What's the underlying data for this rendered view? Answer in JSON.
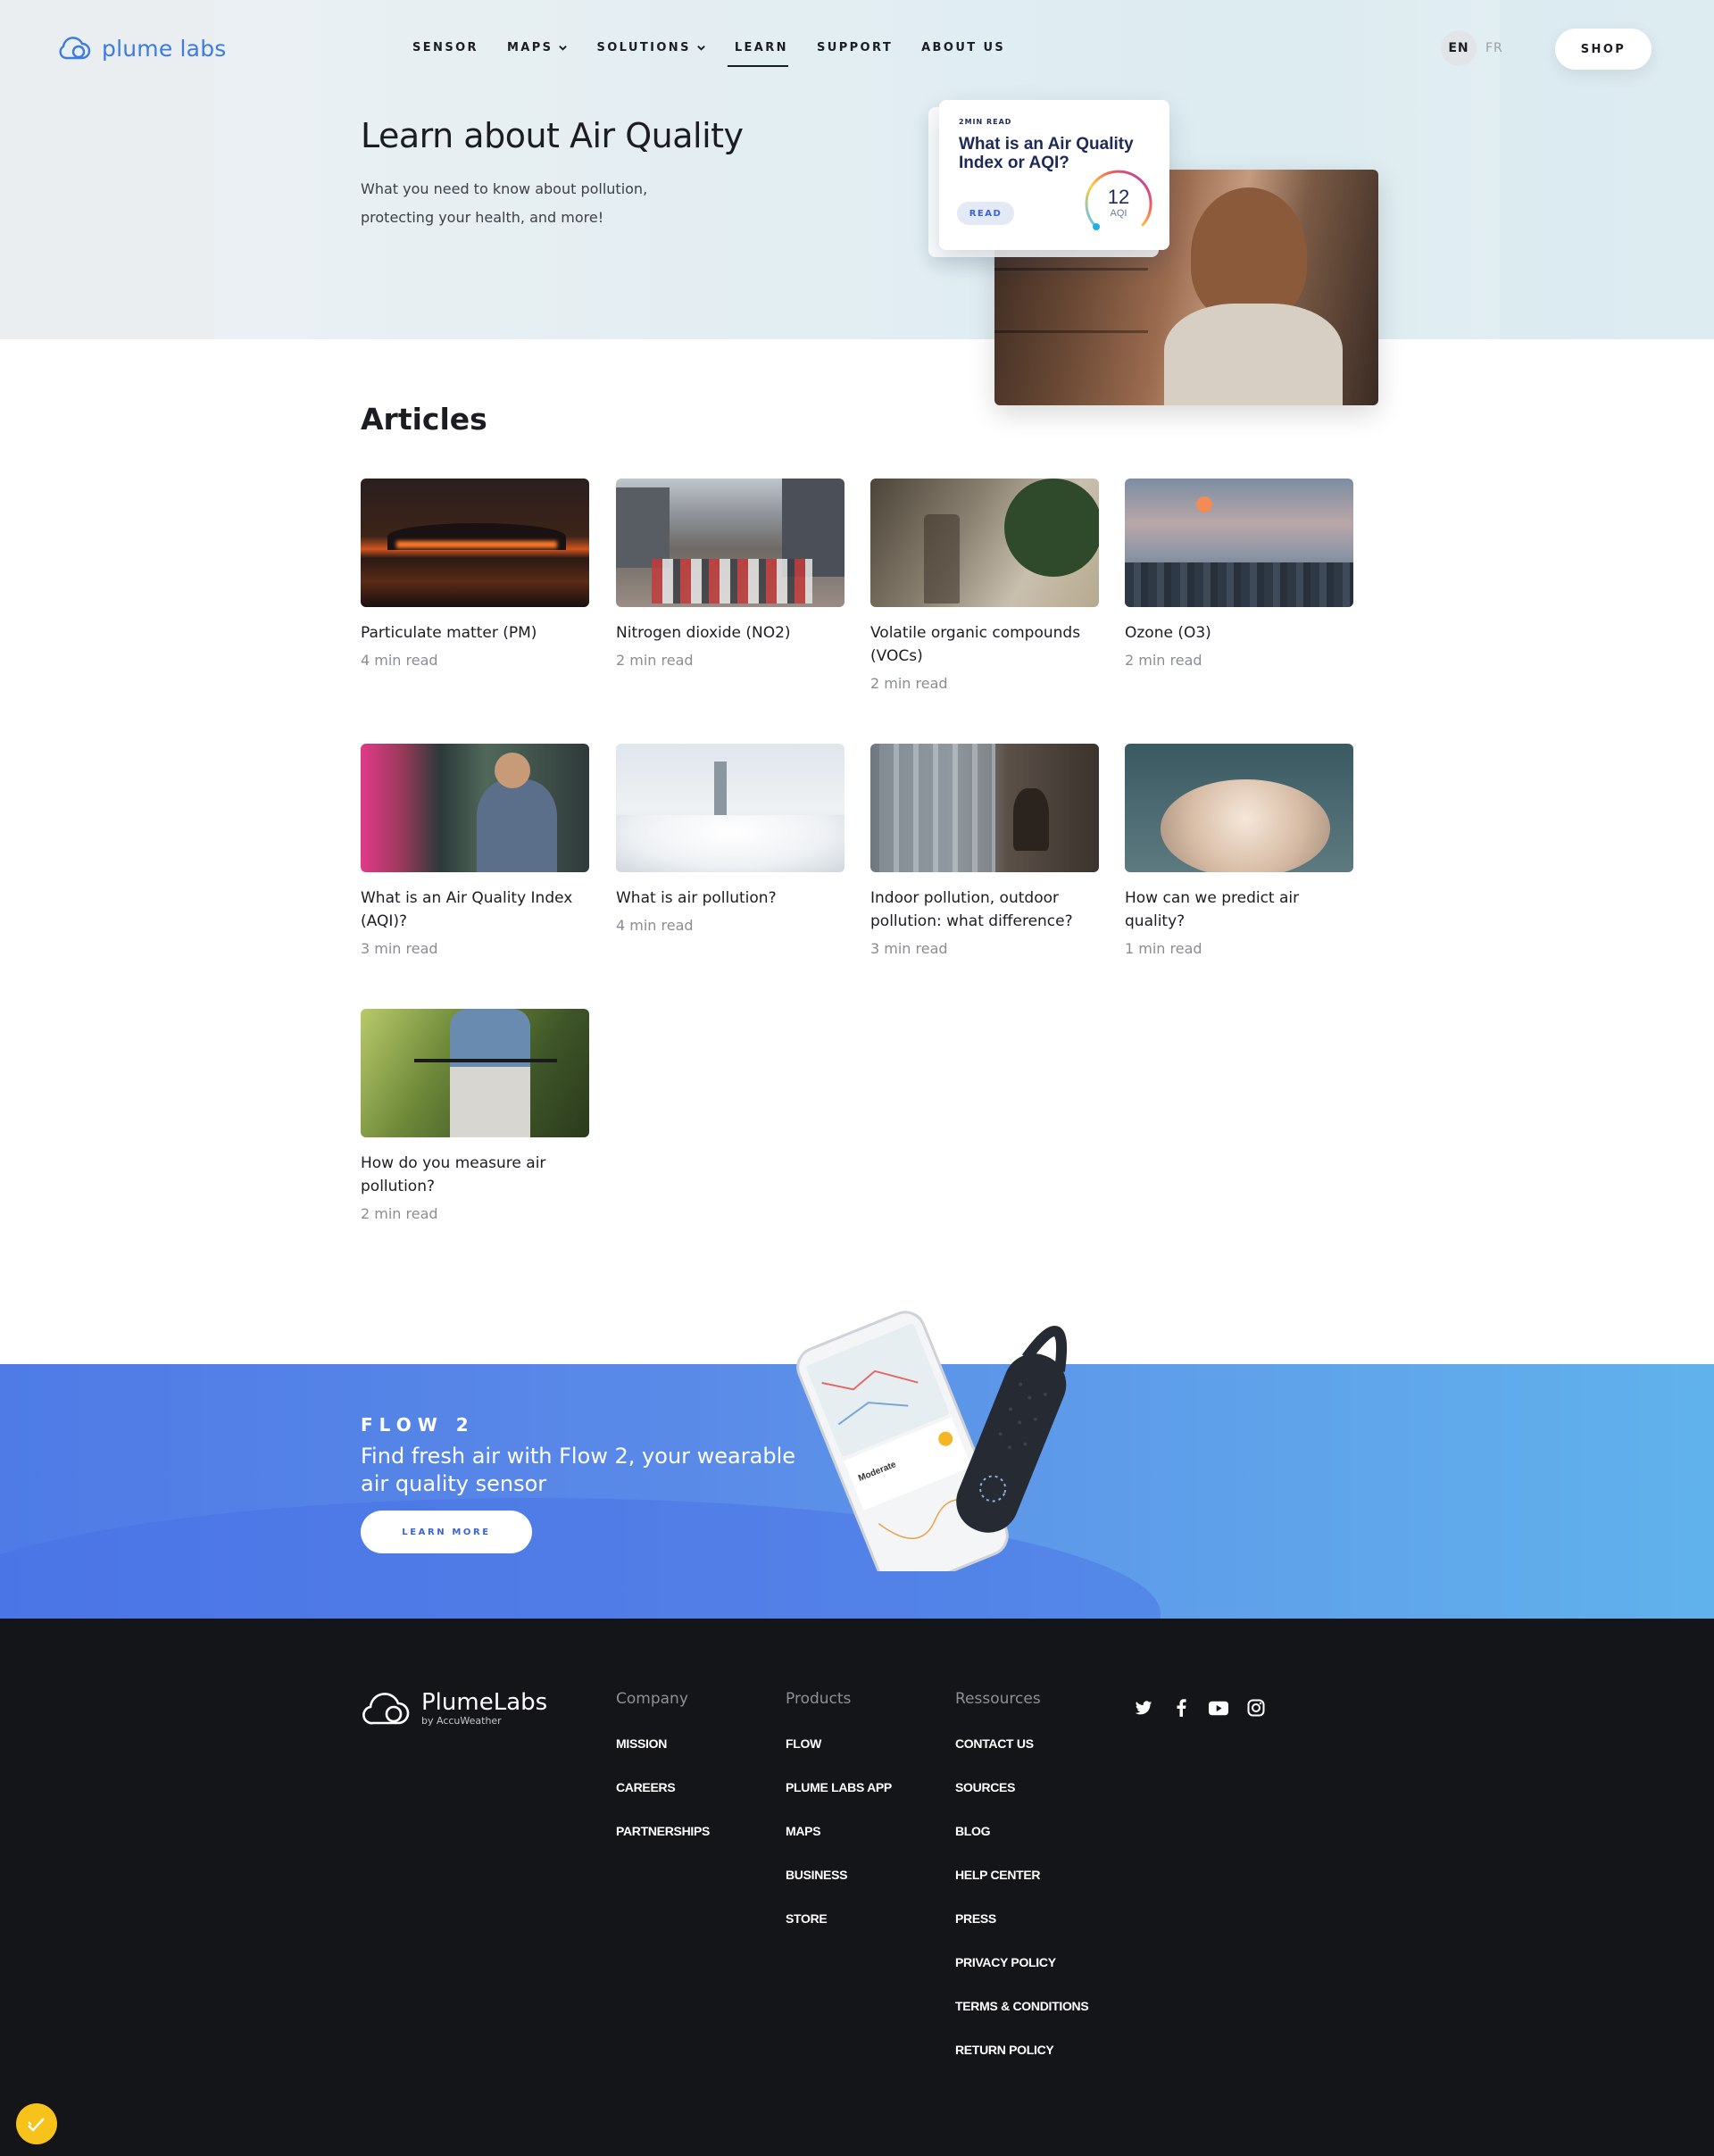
{
  "brand": {
    "logo_text": "plume labs"
  },
  "nav": {
    "items": [
      {
        "label": "SENSOR",
        "has_dropdown": false
      },
      {
        "label": "MAPS",
        "has_dropdown": true
      },
      {
        "label": "SOLUTIONS",
        "has_dropdown": true
      },
      {
        "label": "LEARN",
        "has_dropdown": false,
        "active": true
      },
      {
        "label": "SUPPORT",
        "has_dropdown": false
      },
      {
        "label": "ABOUT US",
        "has_dropdown": false
      }
    ],
    "lang_en": "EN",
    "lang_fr": "FR",
    "shop_label": "SHOP"
  },
  "hero": {
    "title": "Learn about Air Quality",
    "subtitle": "What you need to know about pollution, protecting your health, and more!",
    "card": {
      "kicker": "2MIN READ",
      "title": "What is an Air Quality Index or AQI?",
      "read_label": "READ",
      "aqi_value": "12",
      "aqi_unit": "AQI"
    }
  },
  "articles": {
    "heading": "Articles",
    "items": [
      {
        "title": "Particulate matter (PM)",
        "meta": "4 min read",
        "image": "wildfire"
      },
      {
        "title": "Nitrogen dioxide (NO2)",
        "meta": "2 min read",
        "image": "traffic"
      },
      {
        "title": "Volatile organic compounds (VOCs)",
        "meta": "2 min read",
        "image": "spray-plant"
      },
      {
        "title": "Ozone (O3)",
        "meta": "2 min read",
        "image": "hazy-city"
      },
      {
        "title": "What is an Air Quality Index (AQI)?",
        "meta": "3 min read",
        "image": "commuter"
      },
      {
        "title": "What is air pollution?",
        "meta": "4 min read",
        "image": "fog-city"
      },
      {
        "title": "Indoor pollution, outdoor pollution: what difference?",
        "meta": "3 min read",
        "image": "window"
      },
      {
        "title": "How can we predict air quality?",
        "meta": "1 min read",
        "image": "clouds"
      },
      {
        "title": "How do you measure air pollution?",
        "meta": "2 min read",
        "image": "cyclist"
      }
    ]
  },
  "flow": {
    "kicker": "FLOW 2",
    "title": "Find fresh air with Flow 2, your wearable air quality sensor",
    "button_label": "LEARN MORE",
    "phone_status": "Moderate"
  },
  "footer": {
    "logo_name": "PlumeLabs",
    "logo_by": "by AccuWeather",
    "columns": [
      {
        "heading": "Company",
        "links": [
          "MISSION",
          "CAREERS",
          "PARTNERSHIPS"
        ]
      },
      {
        "heading": "Products",
        "links": [
          "FLOW",
          "PLUME LABS APP",
          "MAPS",
          "BUSINESS",
          "STORE"
        ]
      },
      {
        "heading": "Ressources",
        "links": [
          "CONTACT US",
          "SOURCES",
          "BLOG",
          "HELP CENTER",
          "PRESS",
          "PRIVACY POLICY",
          "TERMS & CONDITIONS",
          "RETURN POLICY"
        ]
      }
    ],
    "socials": [
      "twitter-icon",
      "facebook-icon",
      "youtube-icon",
      "instagram-icon"
    ]
  },
  "colors": {
    "brand_blue": "#3c7be0",
    "footer_bg": "#141518",
    "flow_gradient_start": "#4e7be6",
    "flow_gradient_end": "#60b2ec",
    "cookie_yellow": "#f7c21a"
  }
}
